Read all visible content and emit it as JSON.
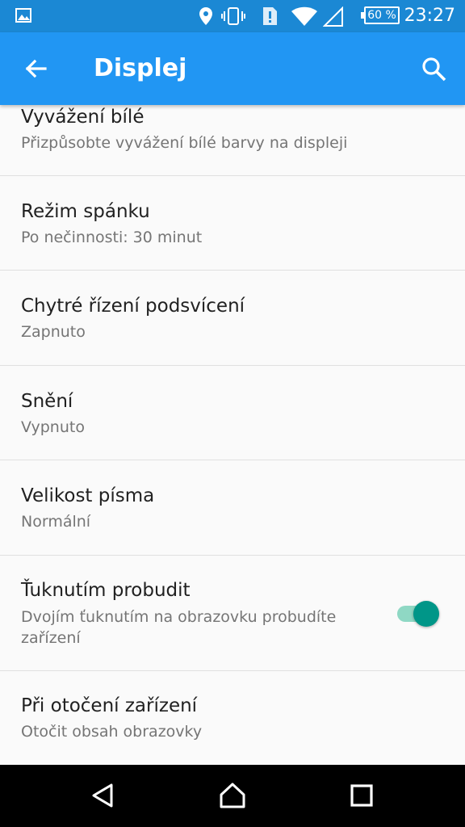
{
  "status_bar": {
    "battery": "60 %",
    "time": "23:27",
    "icons": [
      "image-icon",
      "location-icon",
      "vibrate-icon",
      "alert-icon",
      "wifi-icon",
      "cell-signal-icon"
    ]
  },
  "app_bar": {
    "title": "Displej",
    "icons": [
      "back-arrow-icon",
      "search-icon"
    ]
  },
  "settings": {
    "items": [
      {
        "title": "Vyvážení bílé",
        "summary": "Přizpůsobte vyvážení bílé barvy na displeji"
      },
      {
        "title": "Režim spánku",
        "summary": "Po nečinnosti: 30 minut"
      },
      {
        "title": "Chytré řízení podsvícení",
        "summary": "Zapnuto"
      },
      {
        "title": "Snění",
        "summary": "Vypnuto"
      },
      {
        "title": "Velikost písma",
        "summary": "Normální"
      },
      {
        "title": "Ťuknutím probudit",
        "summary": "Dvojím ťuknutím na obrazovku probudíte zařízení",
        "toggle_on": true
      },
      {
        "title": "Při otočení zařízení",
        "summary": "Otočit obsah obrazovky"
      }
    ]
  },
  "nav_bar": {
    "icons": [
      "back-triangle-icon",
      "home-icon",
      "recents-icon"
    ]
  },
  "colors": {
    "status_bar": "#1b88d4",
    "app_bar": "#2196f3",
    "toggle_accent": "#009688"
  }
}
